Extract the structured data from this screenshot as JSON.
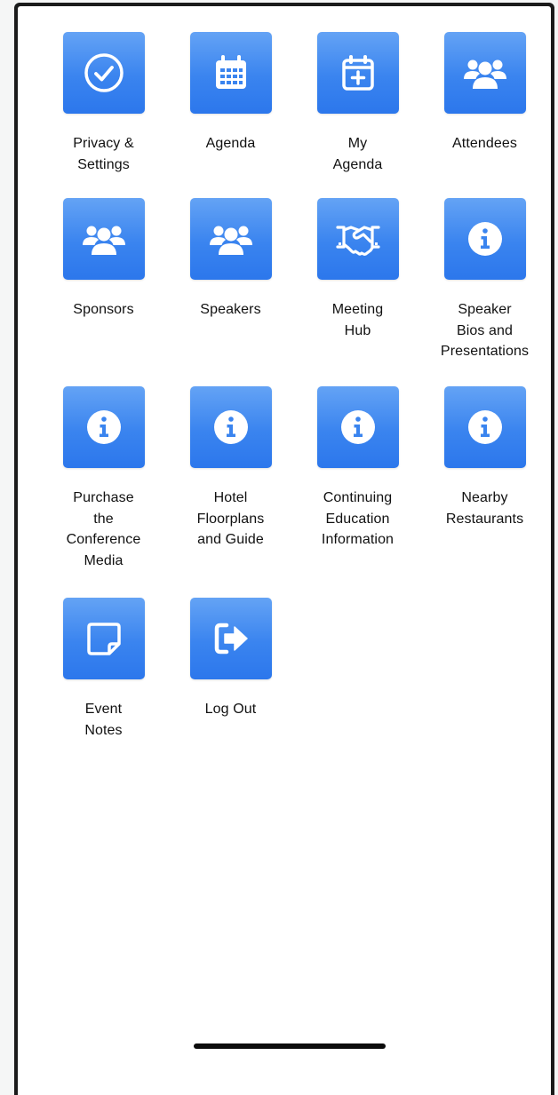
{
  "tiles": [
    {
      "id": "privacy-settings",
      "label": "Privacy &\nSettings",
      "icon": "check-circle-icon"
    },
    {
      "id": "agenda",
      "label": "Agenda",
      "icon": "calendar-icon"
    },
    {
      "id": "my-agenda",
      "label": "My\nAgenda",
      "icon": "calendar-plus-icon"
    },
    {
      "id": "attendees",
      "label": "Attendees",
      "icon": "people-group-icon"
    },
    {
      "id": "sponsors",
      "label": "Sponsors",
      "icon": "people-group-icon"
    },
    {
      "id": "speakers",
      "label": "Speakers",
      "icon": "people-group-icon"
    },
    {
      "id": "meeting-hub",
      "label": "Meeting\nHub",
      "icon": "handshake-icon"
    },
    {
      "id": "speaker-bios",
      "label": "Speaker\nBios and\nPresentations",
      "icon": "info-icon"
    },
    {
      "id": "purchase-media",
      "label": "Purchase\nthe\nConference\nMedia",
      "icon": "info-icon"
    },
    {
      "id": "hotel-floorplans",
      "label": "Hotel\nFloorplans\nand Guide",
      "icon": "info-icon"
    },
    {
      "id": "continuing-education",
      "label": "Continuing\nEducation\nInformation",
      "icon": "info-icon"
    },
    {
      "id": "nearby-restaurants",
      "label": "Nearby\nRestaurants",
      "icon": "info-icon"
    },
    {
      "id": "event-notes",
      "label": "Event\nNotes",
      "icon": "sticky-note-icon"
    },
    {
      "id": "log-out",
      "label": "Log Out",
      "icon": "sign-out-icon"
    }
  ],
  "colors": {
    "tile_top": "#64a3f5",
    "tile_bottom": "#2c77ec",
    "icon_fg": "#ffffff",
    "label": "#111111"
  }
}
